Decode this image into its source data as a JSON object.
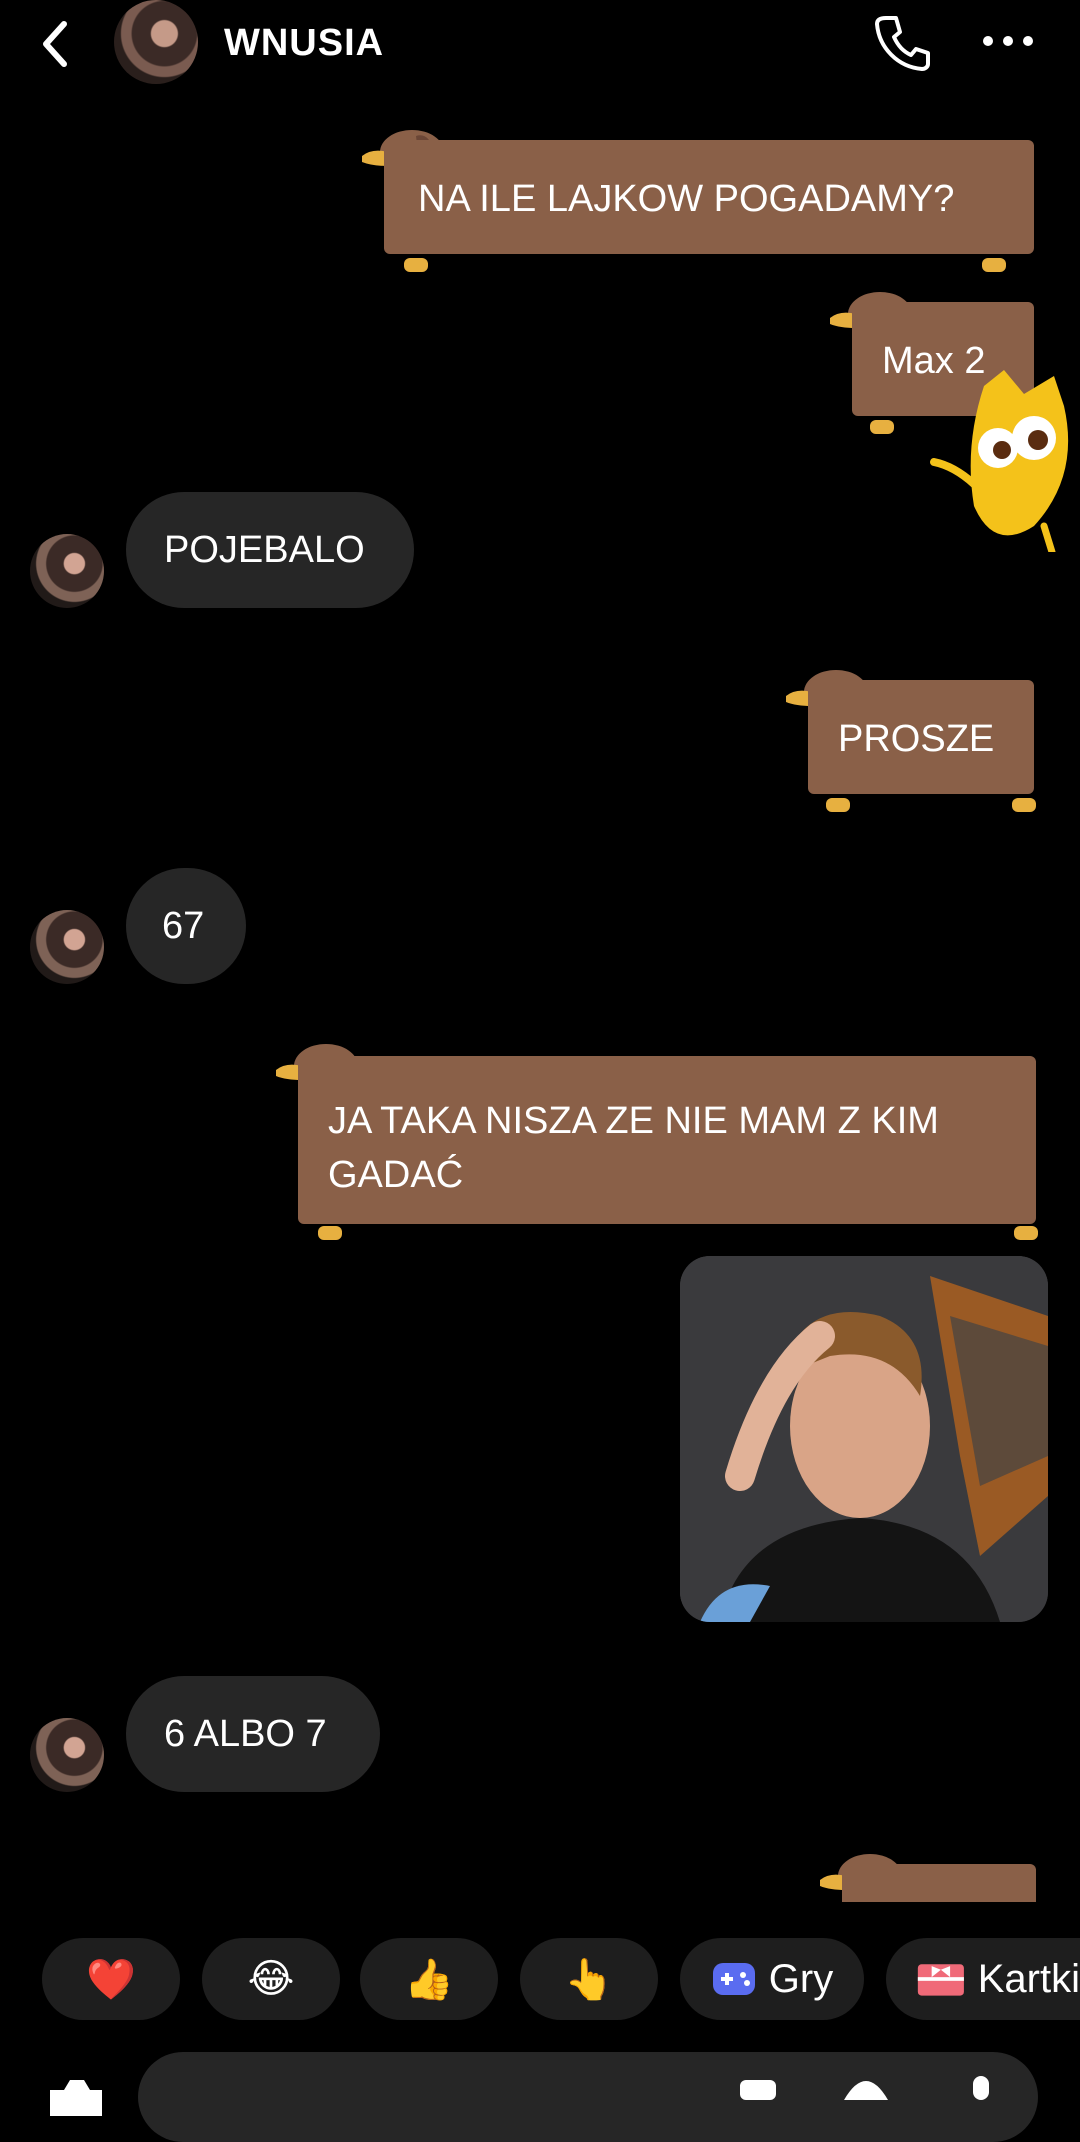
{
  "header": {
    "title": "WNUSIA"
  },
  "messages": {
    "m1": "NA ILE LAJKOW POGADAMY?",
    "m2": "Max 2",
    "m3": "POJEBALO",
    "m4": "PROSZE",
    "m5": "67",
    "m6_line1": "JA TAKA NISZA ZE NIE MAM Z KIM",
    "m6_line2": "GADAĆ",
    "m7": "6 ALBO 7"
  },
  "quick_actions": {
    "heart": "❤️",
    "laugh": "😂",
    "thumbs": "👍",
    "point": "👆",
    "games_label": "Gry",
    "cards_label": "Kartki"
  },
  "colors": {
    "bubble_brown": "#8a6048",
    "received_bg": "#262626",
    "chip_bg": "#1e1e1e"
  }
}
